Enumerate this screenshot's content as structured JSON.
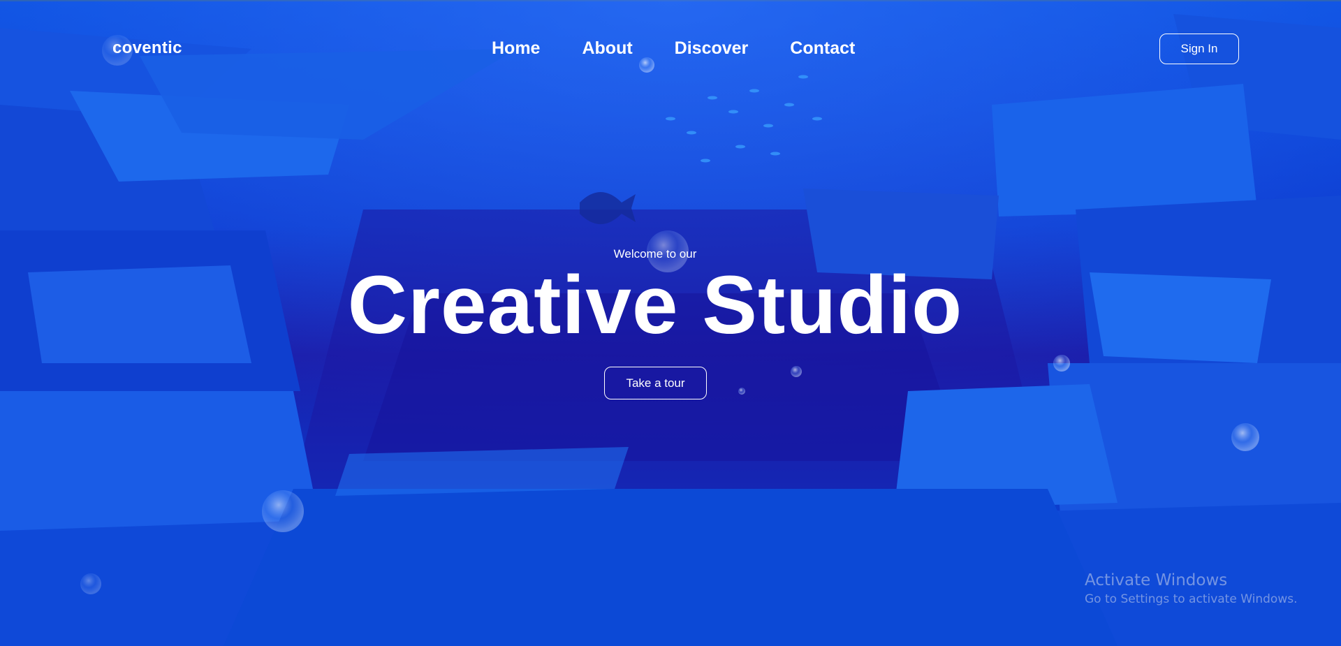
{
  "brand": {
    "logo": "coventic"
  },
  "nav": {
    "items": [
      {
        "label": "Home"
      },
      {
        "label": "About"
      },
      {
        "label": "Discover"
      },
      {
        "label": "Contact"
      }
    ],
    "signin_label": "Sign In"
  },
  "hero": {
    "subtitle": "Welcome to our",
    "title": "Creative Studio",
    "cta_label": "Take a tour"
  },
  "os_watermark": {
    "line1": "Activate Windows",
    "line2": "Go to Settings to activate Windows."
  },
  "colors": {
    "background_deep": "#1a1aa8",
    "background_light": "#0a5be6",
    "text": "#ffffff"
  }
}
